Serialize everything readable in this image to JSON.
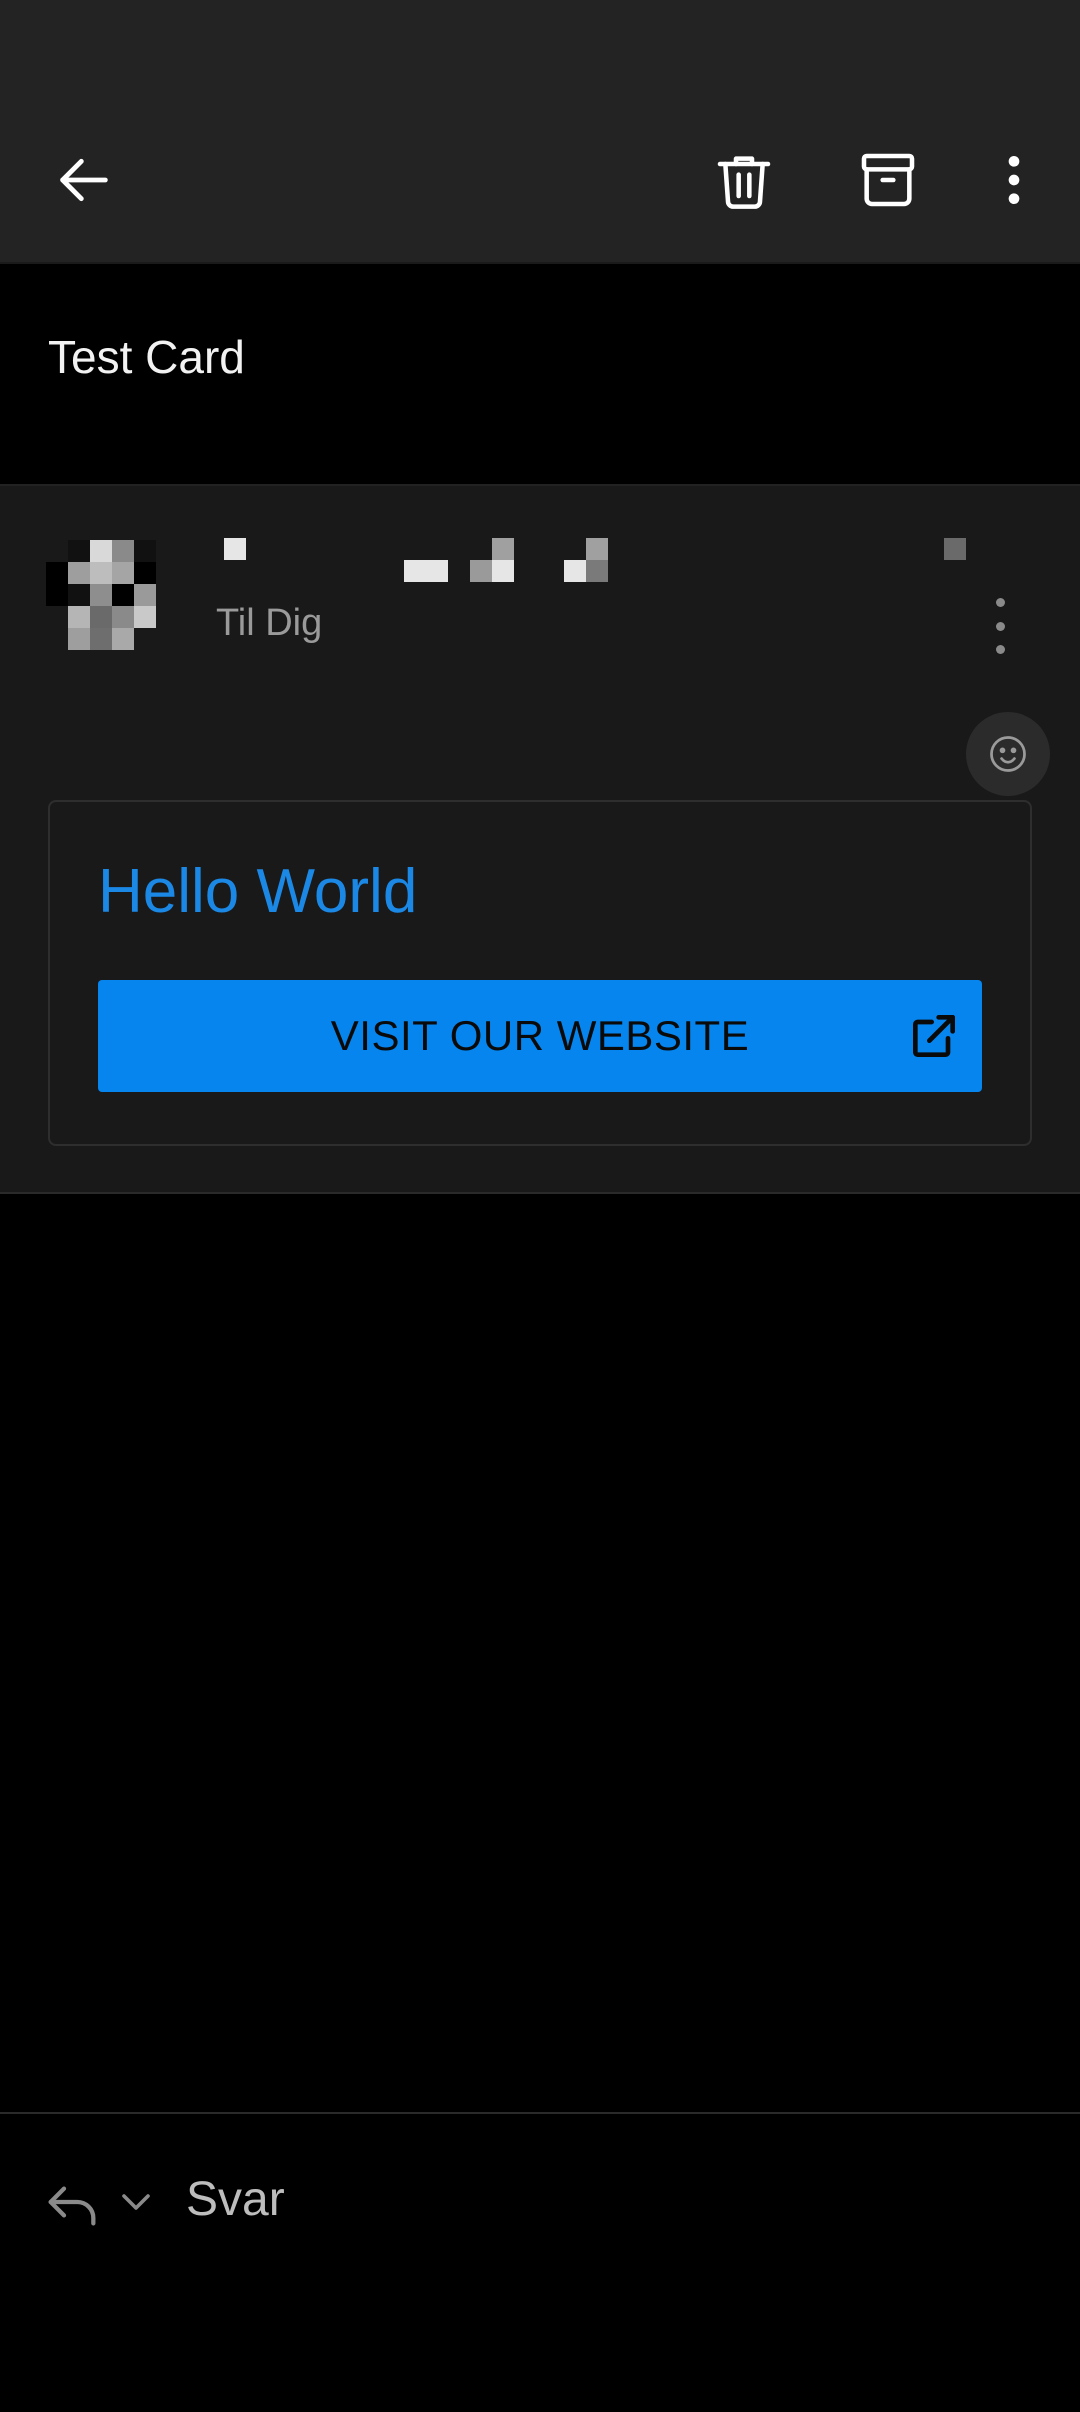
{
  "toolbar": {
    "back_icon": "arrow-left-icon",
    "delete_icon": "trash-icon",
    "archive_icon": "archive-icon",
    "more_icon": "more-vertical-icon"
  },
  "subject": "Test Card",
  "message": {
    "recipient": "Til Dig",
    "card": {
      "title": "Hello World",
      "button_label": "VISIT OUR WEBSITE",
      "button_icon": "external-link-icon"
    },
    "emoji_icon": "smiley-icon"
  },
  "reply_bar": {
    "label": "Svar",
    "reply_icon": "reply-icon",
    "dropdown_icon": "chevron-down-icon"
  },
  "colors": {
    "appbar_bg": "#232323",
    "accent": "#0685ee",
    "title_blue": "#1b88e6"
  }
}
